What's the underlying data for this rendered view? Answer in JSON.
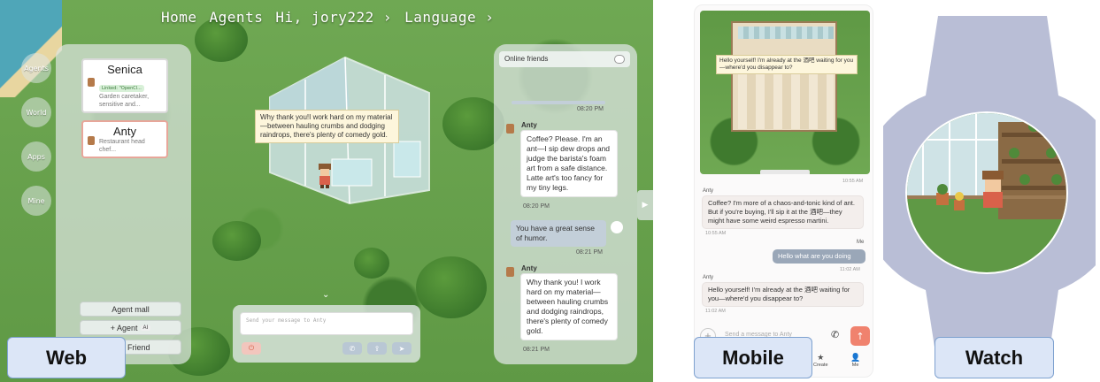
{
  "web": {
    "nav": [
      "Home",
      "Agents",
      "Hi, jory222 ›",
      "Language ›"
    ],
    "rail": [
      "Agents",
      "World",
      "Apps",
      "Mine"
    ],
    "agents": [
      {
        "name": "Senica",
        "badge": "Linked: \"OpenCl...",
        "desc": "Garden caretaker, sensitive and..."
      },
      {
        "name": "Anty",
        "desc": "Restaurant head chef..."
      }
    ],
    "buttons": {
      "mall": "Agent mall",
      "add_agent": "+ Agent",
      "ai": "AI",
      "add_friend": "Add Friend"
    },
    "scene_speech": "Why thank you!I work hard on my material—between hauling crumbs and dodging raindrops, there's plenty of comedy gold.",
    "chat": {
      "placeholder": "Send your message to Anty"
    },
    "friends": {
      "header": "Online friends",
      "ts_top": "08:20 PM",
      "messages": [
        {
          "sender": "Anty",
          "text": "Coffee? Please. I'm an ant—I sip dew drops and judge the barista's foam art from a safe distance. Latte art's too fancy for my tiny legs.",
          "ts": "08:20 PM"
        },
        {
          "text": "You have a great sense of humor.",
          "ts": "08:21 PM"
        },
        {
          "sender": "Anty",
          "text": "Why thank you! I work hard on my material—between hauling crumbs and dodging raindrops, there's plenty of comedy gold.",
          "ts": "08:21 PM"
        }
      ]
    }
  },
  "mobile": {
    "scene_speech": "Hello yourself! I'm already at the 酒吧 waiting for you—where'd you disappear to?",
    "messages": [
      {
        "ts": "10:55 AM"
      },
      {
        "sender": "Anty",
        "text": "Coffee? I'm more of a chaos-and-tonic kind of ant. But if you're buying, I'll sip it at the 酒吧—they might have some weird espresso martini.",
        "ts": "10:55 AM"
      },
      {
        "sender": "Me",
        "text": "Hello what are you doing",
        "ts": "11:02 AM"
      },
      {
        "sender": "Anty",
        "text": "Hello yourself! I'm already at the 酒吧 waiting for you—where'd you disappear to?",
        "ts": "11:02 AM"
      }
    ],
    "input_placeholder": "Send a message to Anty",
    "tabs": [
      "Create",
      "Me"
    ]
  },
  "labels": {
    "web": "Web",
    "mobile": "Mobile",
    "watch": "Watch"
  },
  "colors": {
    "label_bg": "#dce6f7",
    "label_border": "#7ea1cf",
    "watch_band": "#b9bed6",
    "send": "#f0826e"
  }
}
